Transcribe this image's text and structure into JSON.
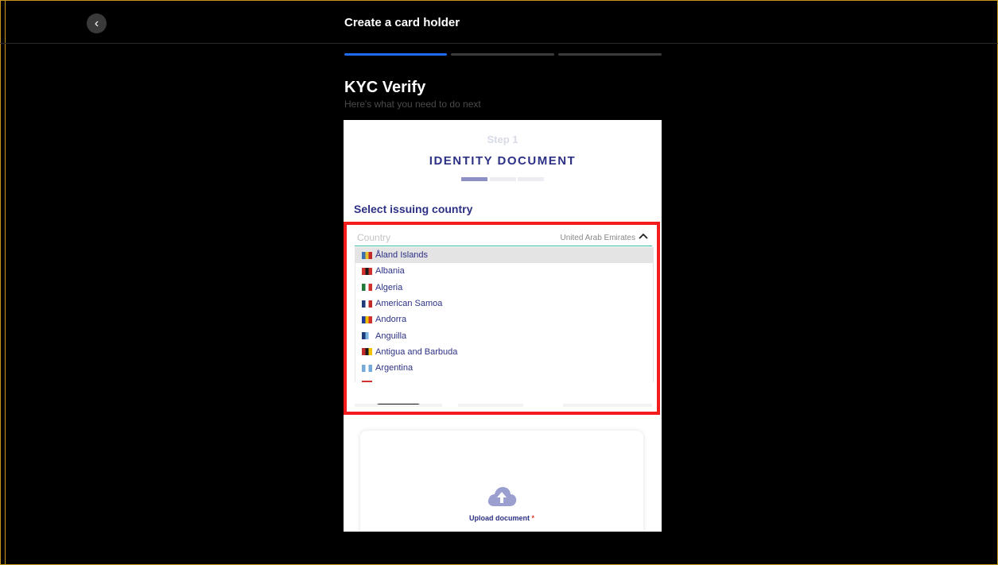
{
  "header": {
    "title": "Create a card holder",
    "back_icon": "chevron-left-icon"
  },
  "page": {
    "title": "KYC Verify",
    "subtitle": "Here's what you need to do next",
    "progress": {
      "total_steps": 3,
      "current_step": 1
    }
  },
  "kyc_widget": {
    "step_label": "Step 1",
    "section_title": "IDENTITY DOCUMENT",
    "substep": {
      "total": 3,
      "current": 1
    },
    "select_label": "Select issuing country",
    "country_field": {
      "placeholder": "Country",
      "selected_value": "United Arab Emirates"
    },
    "countries": [
      {
        "name": "Åland Islands",
        "flag": [
          "#3a6fb0",
          "#e8c22a",
          "#c22a2a"
        ],
        "hovered": true
      },
      {
        "name": "Albania",
        "flag": [
          "#d0312d",
          "#1a1a1a",
          "#d0312d"
        ],
        "hovered": false
      },
      {
        "name": "Algeria",
        "flag": [
          "#1f7a3a",
          "#ffffff",
          "#d0312d"
        ],
        "hovered": false
      },
      {
        "name": "American Samoa",
        "flag": [
          "#1e3a7a",
          "#ffffff",
          "#c22a2a"
        ],
        "hovered": false
      },
      {
        "name": "Andorra",
        "flag": [
          "#1e3a9a",
          "#f2c200",
          "#d0312d"
        ],
        "hovered": false
      },
      {
        "name": "Anguilla",
        "flag": [
          "#1e3a7a",
          "#7fb3e0",
          "#ffffff"
        ],
        "hovered": false
      },
      {
        "name": "Antigua and Barbuda",
        "flag": [
          "#c22a2a",
          "#1a1a1a",
          "#f2c200"
        ],
        "hovered": false
      },
      {
        "name": "Argentina",
        "flag": [
          "#75aadb",
          "#ffffff",
          "#75aadb"
        ],
        "hovered": false
      }
    ],
    "upload": {
      "label": "Upload document",
      "required_mark": "*",
      "icon": "cloud-upload-icon"
    }
  },
  "colors": {
    "accent": "#1f6cf0",
    "brand_navy": "#2c3185",
    "highlight": "#f31b1b",
    "frame": "#c8951d"
  }
}
